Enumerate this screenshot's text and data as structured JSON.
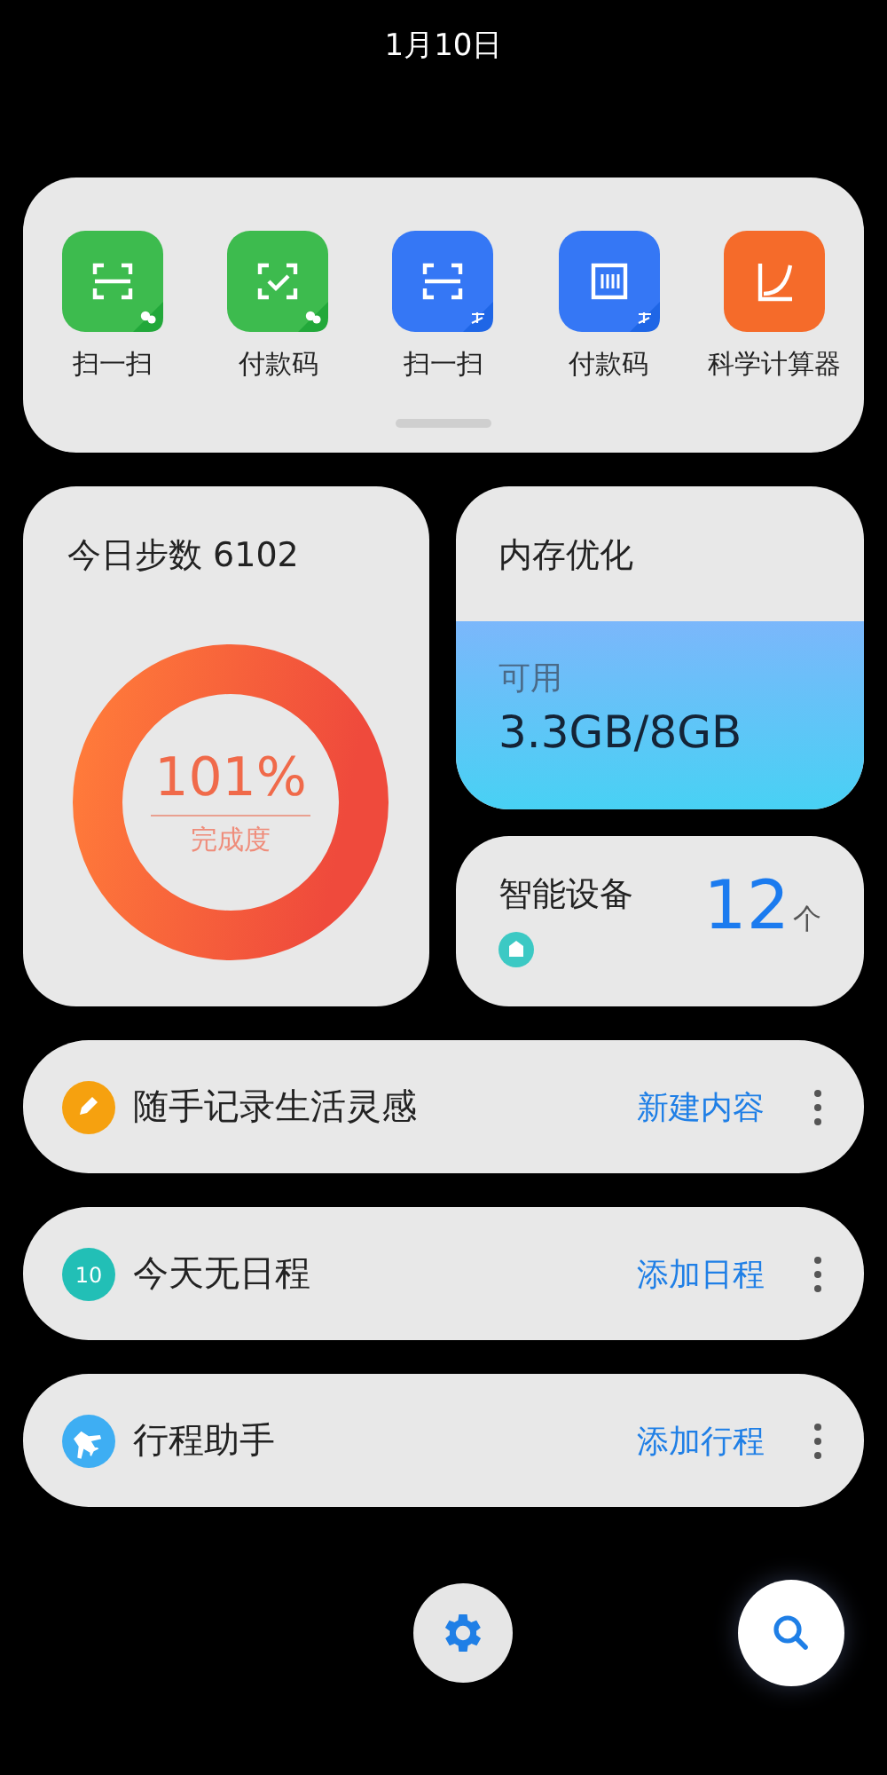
{
  "date": "1月10日",
  "shortcuts": [
    {
      "label": "扫一扫",
      "kind": "scan",
      "color": "#3dbb4e",
      "badge": {
        "kind": "chat"
      }
    },
    {
      "label": "付款码",
      "kind": "pay",
      "color": "#3dbb4e",
      "badge": {
        "kind": "chat"
      }
    },
    {
      "label": "扫一扫",
      "kind": "scan",
      "color": "#3577f5",
      "badge": {
        "kind": "pay"
      }
    },
    {
      "label": "付款码",
      "kind": "barcode",
      "color": "#3577f5",
      "badge": {
        "kind": "pay"
      }
    },
    {
      "label": "科学计算器",
      "kind": "chart",
      "color": "#f56b2a"
    }
  ],
  "steps": {
    "title": "今日步数 6102",
    "percent": "101%",
    "caption": "完成度"
  },
  "memory": {
    "title": "内存优化",
    "label": "可用",
    "value": "3.3GB/8GB"
  },
  "devices": {
    "title": "智能设备",
    "count": "12",
    "unit": "个"
  },
  "rows": [
    {
      "kind": "note",
      "title": "随手记录生活灵感",
      "action": "新建内容",
      "color": "#f6a10f"
    },
    {
      "kind": "calendar",
      "badge_text": "10",
      "title": "今天无日程",
      "action": "添加日程",
      "color": "#22bfb6"
    },
    {
      "kind": "plane",
      "title": "行程助手",
      "action": "添加行程",
      "color": "#3eaef3"
    }
  ]
}
